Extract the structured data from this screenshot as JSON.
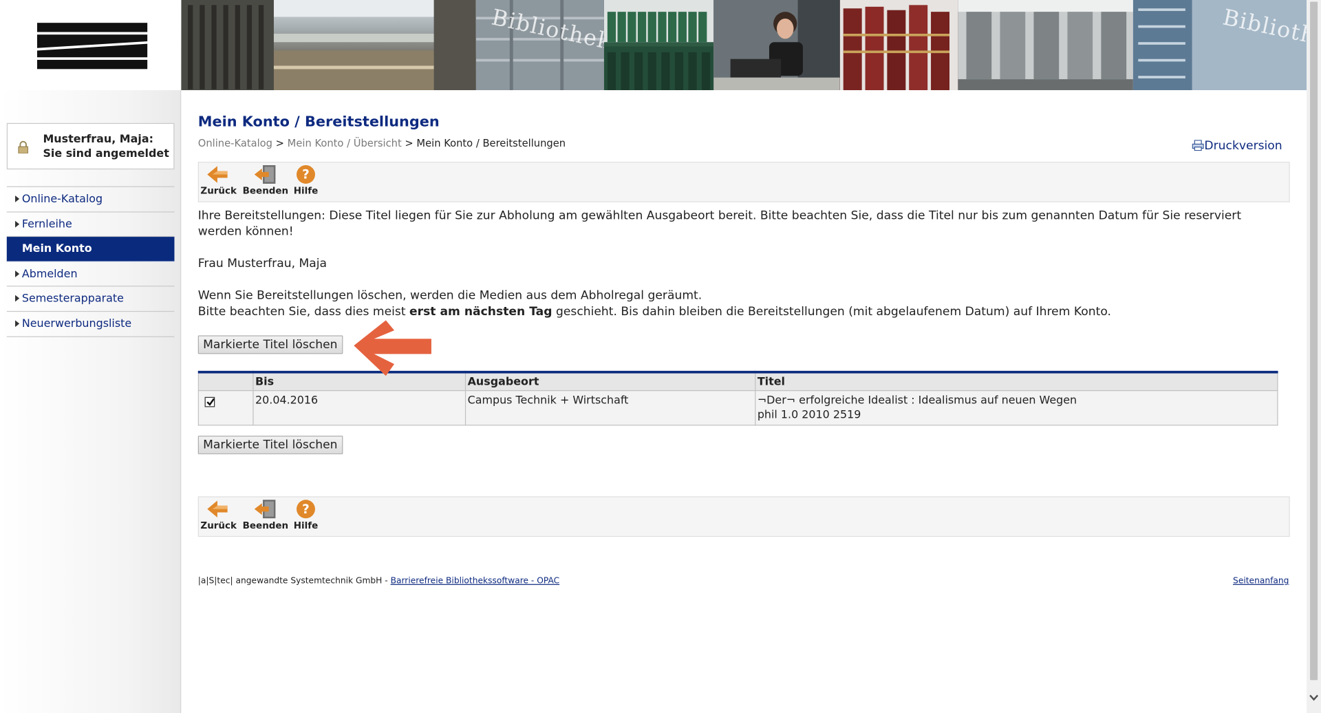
{
  "header": {
    "banner_words": [
      "Bibliothek",
      "Biblioth"
    ]
  },
  "sidebar": {
    "login_status": "Musterfrau, Maja: Sie sind angemeldet",
    "items": [
      {
        "label": "Online-Katalog",
        "active": false
      },
      {
        "label": "Fernleihe",
        "active": false
      },
      {
        "label": "Mein Konto",
        "active": true
      },
      {
        "label": "Abmelden",
        "active": false
      },
      {
        "label": "Semesterapparate",
        "active": false
      },
      {
        "label": "Neuerwerbungsliste",
        "active": false
      }
    ]
  },
  "main": {
    "title": "Mein Konto / Bereitstellungen",
    "breadcrumb": {
      "link1": "Online-Katalog",
      "sep1": " > ",
      "link2": "Mein Konto / Übersicht",
      "sep2": " > ",
      "current": "Mein Konto / Bereitstellungen"
    },
    "print_label": "Druckversion",
    "toolbar": {
      "back": "Zurück",
      "exit": "Beenden",
      "help": "Hilfe"
    },
    "intro": "Ihre Bereitstellungen: Diese Titel liegen für Sie zur Abholung am gewählten Ausgabeort bereit. Bitte beachten Sie, dass die Titel nur bis zum genannten Datum für Sie reserviert werden können!",
    "user_name": "Frau Musterfrau, Maja",
    "note_line1": "Wenn Sie Bereitstellungen löschen, werden die Medien aus dem Abholregal geräumt.",
    "note_line2_pre": "Bitte beachten Sie, dass dies meist ",
    "note_line2_bold": "erst am nächsten Tag",
    "note_line2_post": " geschieht. Bis dahin bleiben die Bereitstellungen (mit abgelaufenem Datum) auf Ihrem Konto.",
    "delete_button": "Markierte Titel löschen",
    "table": {
      "headers": [
        "",
        "Bis",
        "Ausgabeort",
        "Titel"
      ],
      "rows": [
        {
          "checked": true,
          "until": "20.04.2016",
          "location": "Campus Technik + Wirtschaft",
          "title": "¬Der¬ erfolgreiche Idealist : Idealismus auf neuen Wegen",
          "signature": "phil 1.0 2010 2519"
        }
      ]
    }
  },
  "footer": {
    "company": "|a|S|tec| angewandte Systemtechnik GmbH - ",
    "link": "Barrierefreie Bibliothekssoftware - OPAC",
    "top_link": "Seitenanfang"
  },
  "colors": {
    "brand_blue": "#0a2a7e",
    "link_blue": "#0e2a80",
    "annotation_arrow": "#e5623f",
    "toolbar_orange": "#e0882a"
  }
}
